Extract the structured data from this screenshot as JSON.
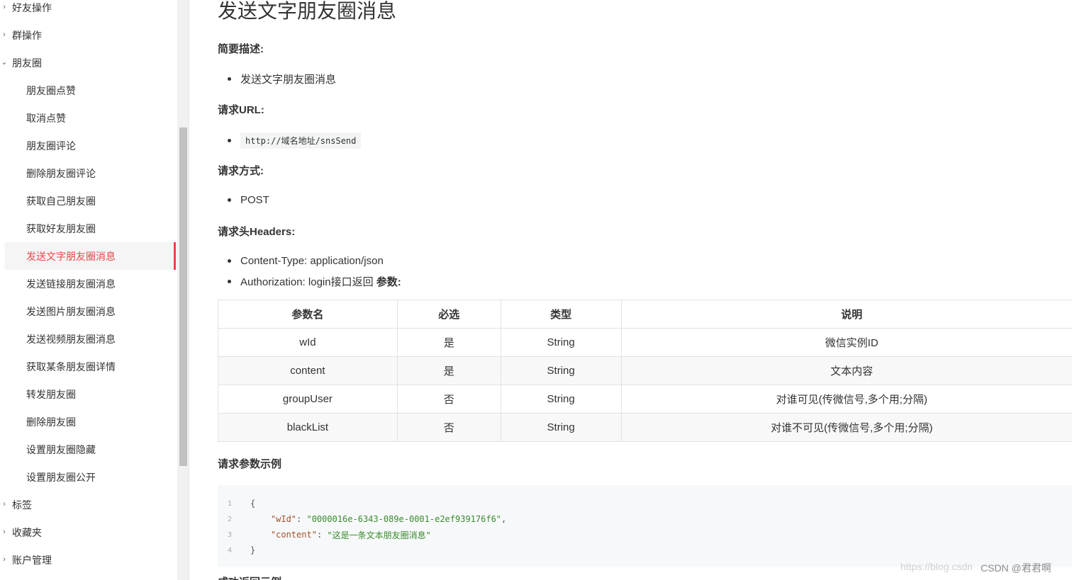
{
  "sidebar": {
    "items": [
      {
        "label": "好友操作",
        "type": "group",
        "expanded": false
      },
      {
        "label": "群操作",
        "type": "group",
        "expanded": false
      },
      {
        "label": "朋友圈",
        "type": "group",
        "expanded": true
      },
      {
        "label": "朋友圈点赞",
        "type": "child"
      },
      {
        "label": "取消点赞",
        "type": "child"
      },
      {
        "label": "朋友圈评论",
        "type": "child"
      },
      {
        "label": "删除朋友圈评论",
        "type": "child"
      },
      {
        "label": "获取自己朋友圈",
        "type": "child"
      },
      {
        "label": "获取好友朋友圈",
        "type": "child"
      },
      {
        "label": "发送文字朋友圈消息",
        "type": "child",
        "active": true
      },
      {
        "label": "发送链接朋友圈消息",
        "type": "child"
      },
      {
        "label": "发送图片朋友圈消息",
        "type": "child"
      },
      {
        "label": "发送视频朋友圈消息",
        "type": "child"
      },
      {
        "label": "获取某条朋友圈详情",
        "type": "child"
      },
      {
        "label": "转发朋友圈",
        "type": "child"
      },
      {
        "label": "删除朋友圈",
        "type": "child"
      },
      {
        "label": "设置朋友圈隐藏",
        "type": "child"
      },
      {
        "label": "设置朋友圈公开",
        "type": "child"
      },
      {
        "label": "标签",
        "type": "group",
        "expanded": false
      },
      {
        "label": "收藏夹",
        "type": "group",
        "expanded": false
      },
      {
        "label": "账户管理",
        "type": "group",
        "expanded": false
      }
    ],
    "active_color": "#e8454a"
  },
  "main": {
    "title": "发送文字朋友圈消息",
    "summary_label": "简要描述:",
    "summary_item": "发送文字朋友圈消息",
    "url_label": "请求URL:",
    "url_value": "http://域名地址/snsSend",
    "method_label": "请求方式:",
    "method_value": "POST",
    "headers_label": "请求头Headers:",
    "header_content_type": "Content-Type: application/json",
    "header_auth": "Authorization: login接口返回",
    "params_inline_label": "参数:",
    "table": {
      "headers": [
        "参数名",
        "必选",
        "类型",
        "说明"
      ],
      "rows": [
        [
          "wId",
          "是",
          "String",
          "微信实例ID"
        ],
        [
          "content",
          "是",
          "String",
          "文本内容"
        ],
        [
          "groupUser",
          "否",
          "String",
          "对谁可见(传微信号,多个用;分隔)"
        ],
        [
          "blackList",
          "否",
          "String",
          "对谁不可见(传微信号,多个用;分隔)"
        ]
      ]
    },
    "example_label": "请求参数示例",
    "code": {
      "line_numbers": [
        "1",
        "2",
        "3",
        "4"
      ],
      "open_brace": "{",
      "wid_key": "\"wId\"",
      "wid_value": "\"0000016e-6343-089e-0001-e2ef939176f6\"",
      "content_key": "\"content\"",
      "content_value": "\"这是一条文本朋友圈消息\"",
      "close_brace": "}"
    },
    "next_heading": "成功返回示例"
  },
  "watermark": {
    "faint": "https://blog.csdn",
    "text": "CSDN @君君啊"
  }
}
